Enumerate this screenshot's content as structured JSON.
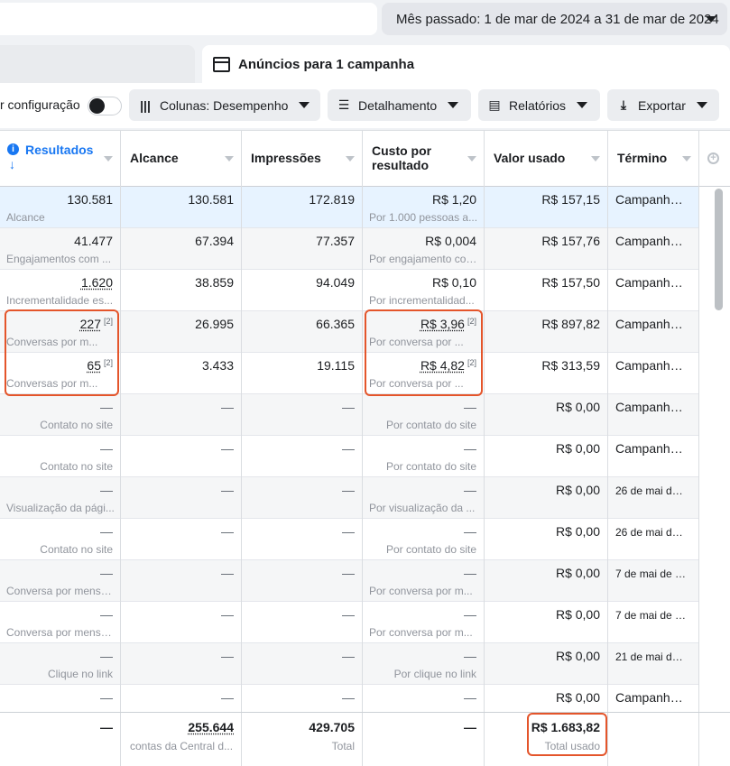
{
  "header": {
    "date_range_label": "Mês passado: 1 de mar de 2024 a 31 de mar de 2024"
  },
  "tabs": {
    "active_label": "Anúncios para 1 campanha"
  },
  "toolbar": {
    "config_text": "r configuração",
    "columns_label": "Colunas: Desempenho",
    "breakdown_label": "Detalhamento",
    "reports_label": "Relatórios",
    "export_label": "Exportar"
  },
  "columns": [
    "Resultados",
    "Alcance",
    "Impressões",
    "Custo por resultado",
    "Valor usado",
    "Término"
  ],
  "column_cost_line1": "Custo por",
  "column_cost_line2": "resultado",
  "rows": [
    {
      "result": "130.581",
      "result_sub": "Alcance",
      "reach": "130.581",
      "impressions": "172.819",
      "cost": "R$ 1,20",
      "cost_sub": "Por 1.000 pessoas a...",
      "spent": "R$ 157,15",
      "end": "Campanha..."
    },
    {
      "result": "41.477",
      "result_sub": "Engajamentos com ...",
      "reach": "67.394",
      "impressions": "77.357",
      "cost": "R$ 0,004",
      "cost_sub": "Por engajamento com...",
      "spent": "R$ 157,76",
      "end": "Campanha..."
    },
    {
      "result": "1.620",
      "result_sub": "Incrementalidade es...",
      "reach": "38.859",
      "impressions": "94.049",
      "cost": "R$ 0,10",
      "cost_sub": "Por incrementalidad...",
      "spent": "R$ 157,50",
      "end": "Campanha..."
    },
    {
      "result": "227",
      "result_badge": "[2]",
      "result_sub": "Conversas por m...",
      "reach": "26.995",
      "impressions": "66.365",
      "cost": "R$ 3,96",
      "cost_badge": "[2]",
      "cost_sub": "Por conversa por ...",
      "spent": "R$ 897,82",
      "end": "Campanha..."
    },
    {
      "result": "65",
      "result_badge": "[2]",
      "result_sub": "Conversas por m...",
      "reach": "3.433",
      "impressions": "19.115",
      "cost": "R$ 4,82",
      "cost_badge": "[2]",
      "cost_sub": "Por conversa por ...",
      "spent": "R$ 313,59",
      "end": "Campanha..."
    },
    {
      "result": "—",
      "result_sub": "Contato no site",
      "reach": "—",
      "impressions": "—",
      "cost": "—",
      "cost_sub": "Por contato do site",
      "spent": "R$ 0,00",
      "end": "Campanha..."
    },
    {
      "result": "—",
      "result_sub": "Contato no site",
      "reach": "—",
      "impressions": "—",
      "cost": "—",
      "cost_sub": "Por contato do site",
      "spent": "R$ 0,00",
      "end": "Campanha..."
    },
    {
      "result": "—",
      "result_sub": "Visualização da pági...",
      "reach": "—",
      "impressions": "—",
      "cost": "—",
      "cost_sub": "Por visualização da ...",
      "spent": "R$ 0,00",
      "end": "26 de mai de ..."
    },
    {
      "result": "—",
      "result_sub": "Contato no site",
      "reach": "—",
      "impressions": "—",
      "cost": "—",
      "cost_sub": "Por contato do site",
      "spent": "R$ 0,00",
      "end": "26 de mai de ..."
    },
    {
      "result": "—",
      "result_sub": "Conversa por mensa...",
      "reach": "—",
      "impressions": "—",
      "cost": "—",
      "cost_sub": "Por conversa por m...",
      "spent": "R$ 0,00",
      "end": "7 de mai de 2..."
    },
    {
      "result": "—",
      "result_sub": "Conversa por mensa...",
      "reach": "—",
      "impressions": "—",
      "cost": "—",
      "cost_sub": "Por conversa por m...",
      "spent": "R$ 0,00",
      "end": "7 de mai de 2..."
    },
    {
      "result": "—",
      "result_sub": "Clique no link",
      "reach": "—",
      "impressions": "—",
      "cost": "—",
      "cost_sub": "Por clique no link",
      "spent": "R$ 0,00",
      "end": "21 de mai de ..."
    },
    {
      "result": "—",
      "result_sub": "",
      "reach": "—",
      "impressions": "—",
      "cost": "—",
      "cost_sub": "",
      "spent": "R$ 0,00",
      "end": "Campanha..."
    }
  ],
  "totals": {
    "result": "—",
    "reach": "255.644",
    "reach_sub": "contas da Central d...",
    "impressions": "429.705",
    "impressions_sub": "Total",
    "cost": "—",
    "spent": "R$ 1.683,82",
    "spent_sub": "Total usado"
  },
  "colors": {
    "accent": "#1877f2",
    "highlight": "#e4552b",
    "selected_row": "#e7f3ff"
  },
  "icons": [
    "columns-icon",
    "breakdown-icon",
    "reports-icon",
    "download-icon",
    "add-column-icon",
    "info-icon",
    "sort-down-arrow-icon"
  ]
}
